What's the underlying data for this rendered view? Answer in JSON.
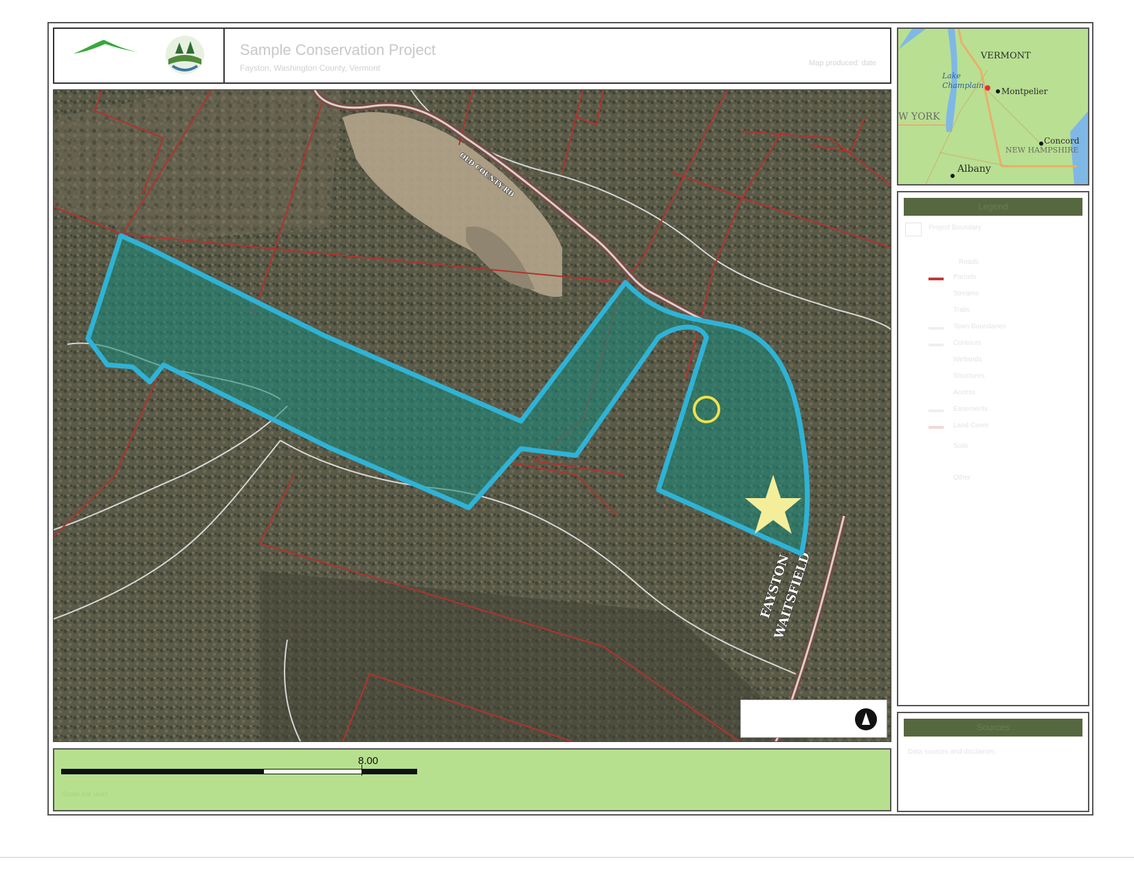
{
  "header": {
    "title": "Sample Conservation Project",
    "subtitle": "Fayston, Washington County, Vermont",
    "date": "Map produced: date"
  },
  "map": {
    "road_labels": {
      "north_road": "OLD COUNTY RD",
      "town_line_top": "FAYSTON",
      "town_line_bottom": "WAITSFIELD"
    }
  },
  "inset": {
    "labels": {
      "vermont": "VERMONT",
      "lake": "Lake Champlain",
      "montpelier": "Montpelier",
      "new_york": "W YORK",
      "concord": "Concord",
      "new_hampshire": "NEW HAMPSHIRE",
      "albany": "Albany"
    }
  },
  "scale": {
    "label": "8.00",
    "note": "Scale bar units"
  },
  "legend": {
    "title": "Legend",
    "items": [
      {
        "label": "Project Boundary"
      },
      {
        "label": "Roads"
      },
      {
        "label": "Parcels"
      },
      {
        "label": "Streams"
      },
      {
        "label": "Trails"
      },
      {
        "label": "Town Boundaries"
      },
      {
        "label": "Contours"
      },
      {
        "label": "Wetlands"
      },
      {
        "label": "Structures"
      },
      {
        "label": "Access"
      },
      {
        "label": "Easements"
      },
      {
        "label": "Land Cover"
      },
      {
        "label": "Soils"
      },
      {
        "label": "Other"
      }
    ]
  },
  "sources": {
    "title": "Sources",
    "text": "Data sources and disclaimer."
  },
  "colors": {
    "boundary": "#2fb3d6",
    "parcel_line": "#b3322e",
    "scale_panel": "#b6e08e",
    "panel_header": "#56683f"
  }
}
